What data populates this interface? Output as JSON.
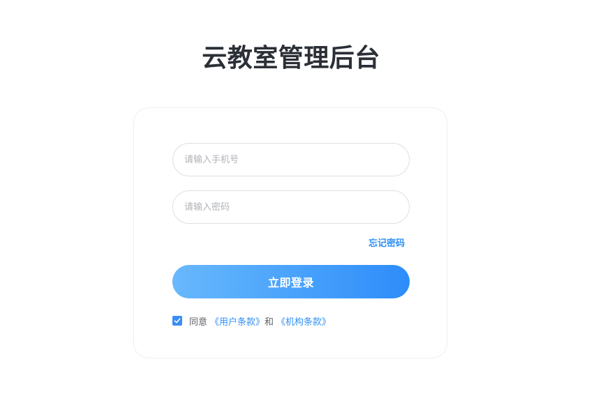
{
  "header": {
    "title": "云教室管理后台"
  },
  "login_form": {
    "phone_placeholder": "请输入手机号",
    "password_placeholder": "请输入密码",
    "forgot_password": "忘记密码",
    "login_button": "立即登录",
    "agreement": {
      "checked": true,
      "prefix": "同意",
      "user_terms": "《用户条款》",
      "conjunction": "和",
      "org_terms": "《机构条款》"
    }
  },
  "colors": {
    "accent": "#2f8ff5",
    "title": "#2b2f36",
    "button_gradient_start": "#68b8fc",
    "button_gradient_end": "#2e8cfa"
  },
  "icons": {
    "checkbox": "check-icon"
  }
}
